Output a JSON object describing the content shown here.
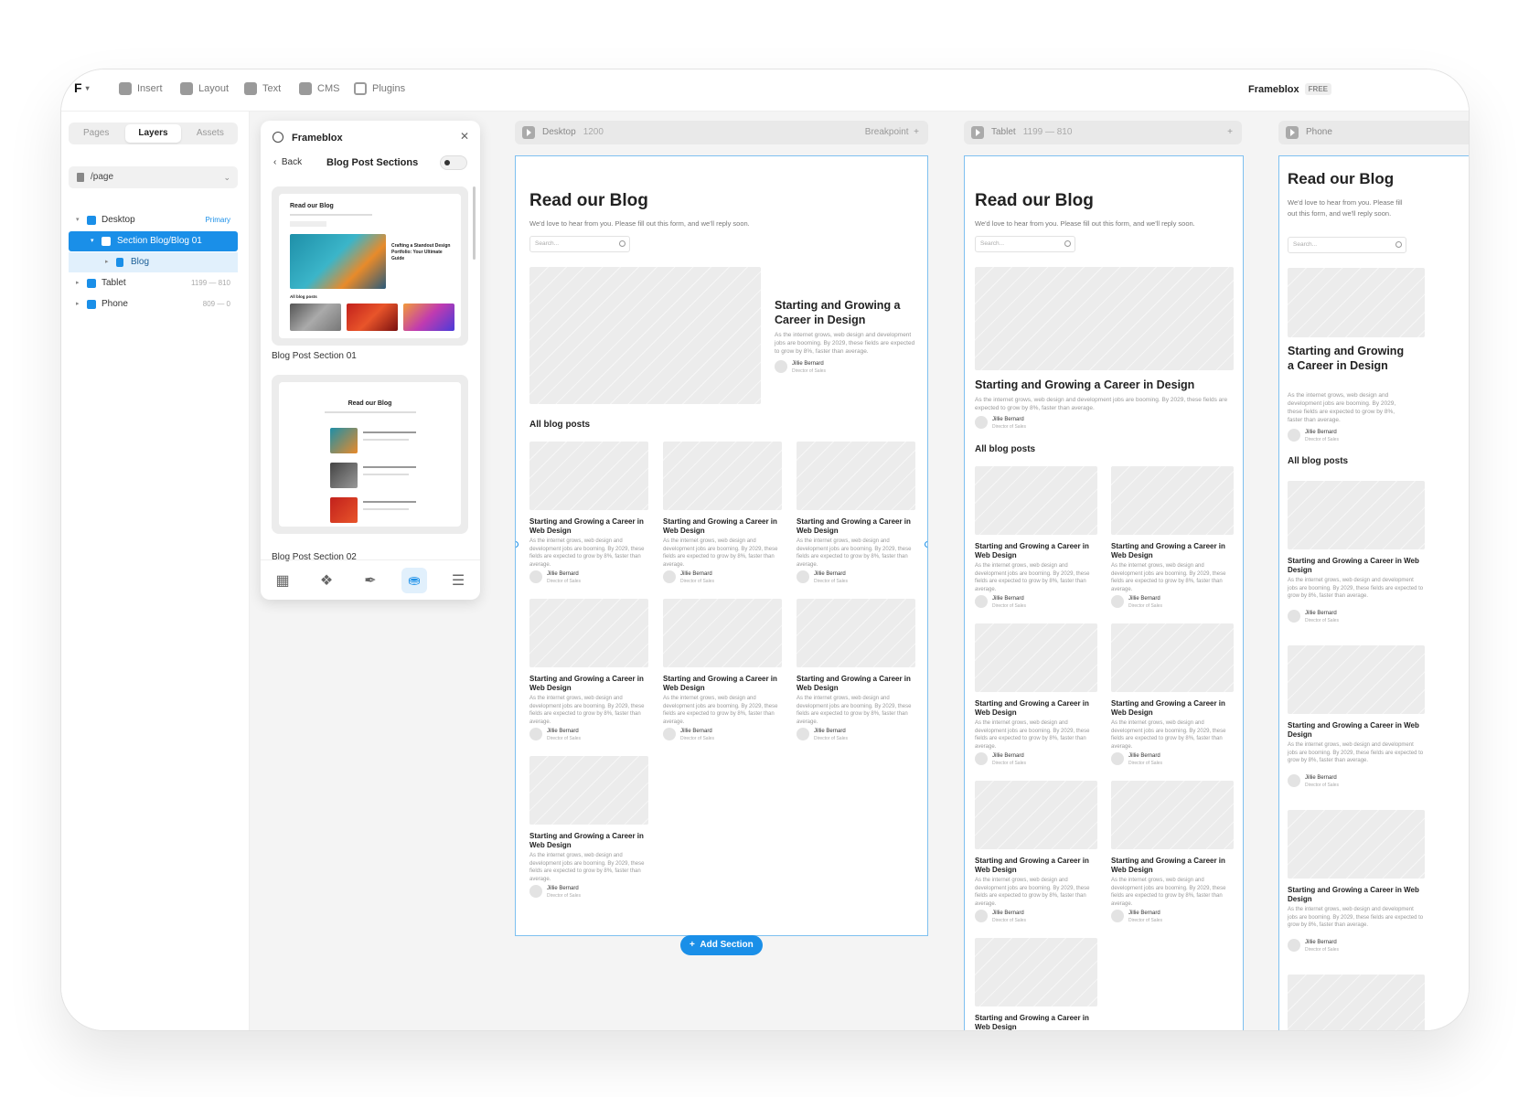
{
  "topbar": {
    "logo": "F",
    "items": [
      {
        "label": "Insert",
        "icon": "plus-square-icon"
      },
      {
        "label": "Layout",
        "icon": "layout-icon"
      },
      {
        "label": "Text",
        "icon": "text-icon"
      },
      {
        "label": "CMS",
        "icon": "database-icon"
      },
      {
        "label": "Plugins",
        "icon": "plugins-icon"
      }
    ],
    "brand": "Frameblox",
    "badge": "FREE"
  },
  "left_panel": {
    "tabs": [
      "Pages",
      "Layers",
      "Assets"
    ],
    "active_tab": "Layers",
    "page": "/page",
    "layers": [
      {
        "label": "Desktop",
        "meta": "Primary"
      },
      {
        "label": "Section Blog/Blog 01",
        "meta": ""
      },
      {
        "label": "Blog",
        "meta": ""
      },
      {
        "label": "Tablet",
        "meta": "1199 — 810"
      },
      {
        "label": "Phone",
        "meta": "809 — 0"
      }
    ]
  },
  "component_panel": {
    "title": "Frameblox",
    "back": "Back",
    "heading": "Blog Post Sections",
    "items": [
      {
        "label": "Blog Post Section 01",
        "preview_title": "Read our Blog",
        "preview_feature": "Crafting a Standout Design Portfolio: Your Ultimate Guide",
        "preview_section": "All blog posts"
      },
      {
        "label": "Blog Post Section 02",
        "preview_title": "Read our Blog"
      }
    ]
  },
  "frames": {
    "desktop": {
      "label": "Desktop",
      "dim": "1200",
      "right": "Breakpoint"
    },
    "tablet": {
      "label": "Tablet",
      "dim": "1199 — 810"
    },
    "phone": {
      "label": "Phone"
    }
  },
  "blog": {
    "title": "Read our Blog",
    "subtitle": "We'd love to hear from you. Please fill out this form, and we'll reply soon.",
    "search_placeholder": "Search...",
    "featured_title": "Starting and Growing a Career in Design",
    "featured_desc": "As the internet grows, web design and development jobs are booming. By 2029, these fields are expected to grow by 8%, faster than average.",
    "author": "Jillie Bernard",
    "role": "Director of Sales",
    "all_posts": "All blog posts",
    "card_title": "Starting and Growing a Career in Web Design",
    "card_desc": "As the internet grows, web design and development jobs are booming. By 2029, these fields are expected to grow by 8%, faster than average."
  },
  "add_section": "Add Section"
}
